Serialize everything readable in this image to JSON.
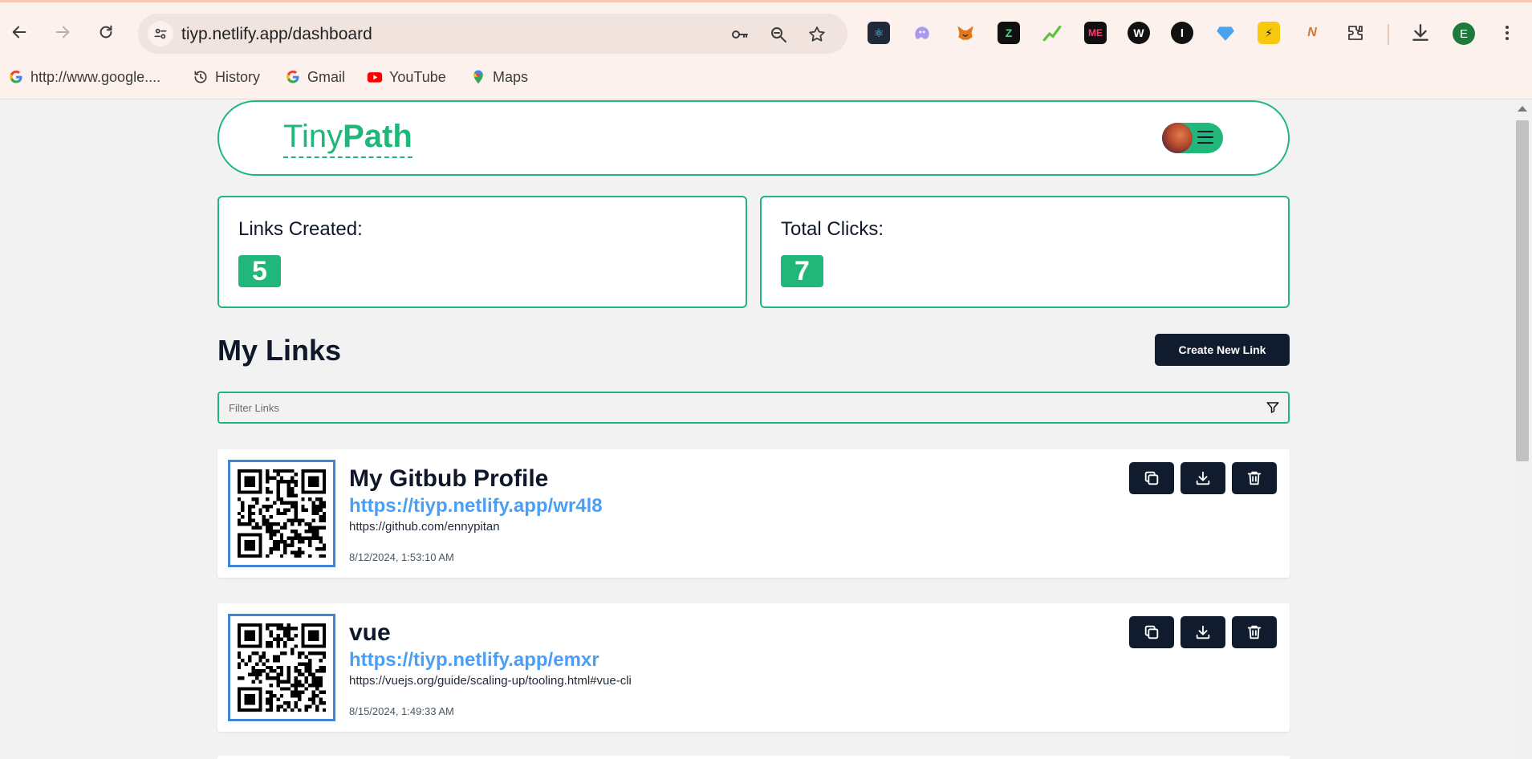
{
  "browser": {
    "url": "tiyp.netlify.app/dashboard",
    "profile_initial": "E",
    "bookmarks": [
      {
        "label": "http://www.google....",
        "icon": "google-icon"
      },
      {
        "label": "History",
        "icon": "history-icon"
      },
      {
        "label": "Gmail",
        "icon": "gmail-icon"
      },
      {
        "label": "YouTube",
        "icon": "youtube-icon"
      },
      {
        "label": "Maps",
        "icon": "maps-icon"
      }
    ],
    "extensions": [
      "react-devtools-icon",
      "ghost-icon",
      "metamask-icon",
      "zebra-icon",
      "chart-icon",
      "me-icon",
      "wordpress-icon",
      "info-icon",
      "diamond-icon",
      "bolt-icon",
      "nv-icon",
      "puzzle-icon"
    ]
  },
  "header": {
    "logo_light": "Tiny",
    "logo_bold": "Path"
  },
  "stats": {
    "links_label": "Links Created:",
    "links_value": "5",
    "clicks_label": "Total Clicks:",
    "clicks_value": "7"
  },
  "links_section": {
    "title": "My Links",
    "create_button": "Create New Link",
    "filter_placeholder": "Filter Links"
  },
  "links": [
    {
      "title": "My Gitbub Profile",
      "short_url": "https://tiyp.netlify.app/wr4l8",
      "original_url": "https://github.com/ennypitan",
      "created": "8/12/2024, 1:53:10 AM"
    },
    {
      "title": "vue",
      "short_url": "https://tiyp.netlify.app/emxr",
      "original_url": "https://vuejs.org/guide/scaling-up/tooling.html#vue-cli",
      "created": "8/15/2024, 1:49:33 AM"
    }
  ],
  "colors": {
    "accent": "#21b67a",
    "dark_button": "#111b2e",
    "link_blue": "#4a9ff5",
    "qr_border": "#3d86d8"
  }
}
